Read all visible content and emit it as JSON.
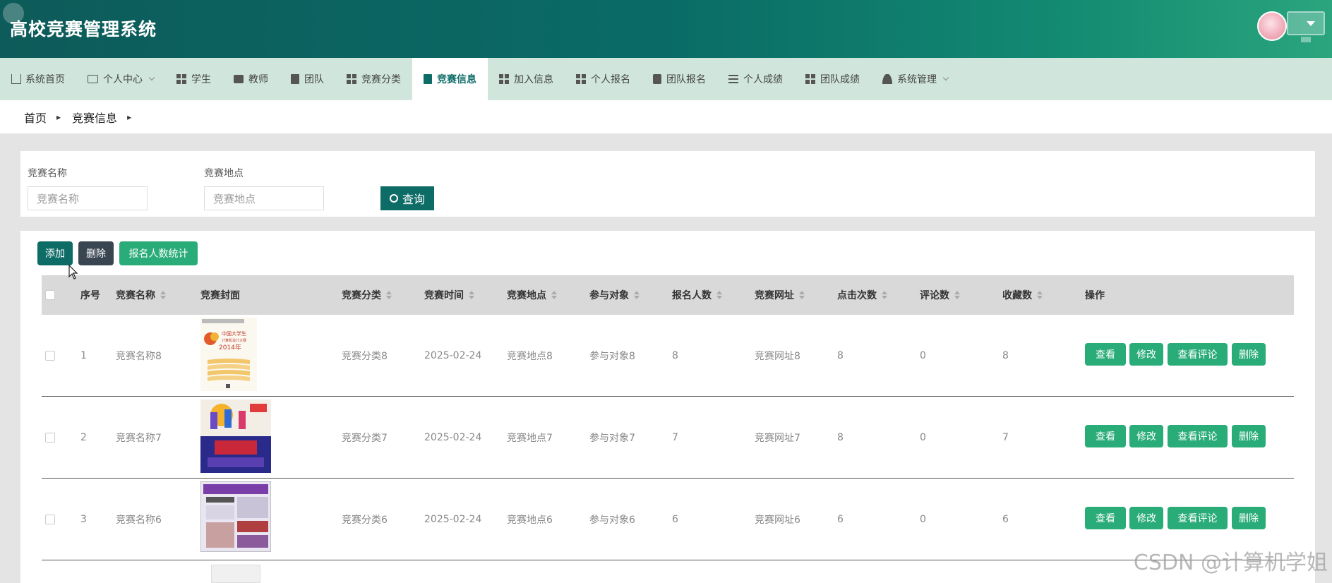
{
  "header": {
    "title": "高校竞赛管理系统"
  },
  "nav": [
    {
      "label": "系统首页",
      "icon": "home-icon"
    },
    {
      "label": "个人中心",
      "icon": "wallet-icon",
      "dropdown": true
    },
    {
      "label": "学生",
      "icon": "grid-icon"
    },
    {
      "label": "教师",
      "icon": "briefcase-icon"
    },
    {
      "label": "团队",
      "icon": "book-icon"
    },
    {
      "label": "竞赛分类",
      "icon": "grid-icon"
    },
    {
      "label": "竞赛信息",
      "icon": "book-icon",
      "active": true
    },
    {
      "label": "加入信息",
      "icon": "grid-icon"
    },
    {
      "label": "个人报名",
      "icon": "grid-icon"
    },
    {
      "label": "团队报名",
      "icon": "clipboard-icon"
    },
    {
      "label": "个人成绩",
      "icon": "list-icon"
    },
    {
      "label": "团队成绩",
      "icon": "grid-icon"
    },
    {
      "label": "系统管理",
      "icon": "user-icon",
      "dropdown": true
    }
  ],
  "breadcrumb": {
    "home": "首页",
    "current": "竞赛信息"
  },
  "search": {
    "name_label": "竞赛名称",
    "name_placeholder": "竞赛名称",
    "location_label": "竞赛地点",
    "location_placeholder": "竞赛地点",
    "query_label": "查询"
  },
  "toolbar": {
    "add": "添加",
    "delete": "删除",
    "stats": "报名人数统计"
  },
  "table": {
    "headers": {
      "index": "序号",
      "name": "竞赛名称",
      "cover": "竞赛封面",
      "category": "竞赛分类",
      "time": "竞赛时间",
      "location": "竞赛地点",
      "audience": "参与对象",
      "signups": "报名人数",
      "url": "竞赛网址",
      "clicks": "点击次数",
      "comments": "评论数",
      "favorites": "收藏数",
      "actions": "操作"
    },
    "action_labels": {
      "view": "查看",
      "edit": "修改",
      "view_comments": "查看评论",
      "delete": "删除"
    },
    "rows": [
      {
        "index": "1",
        "name": "竞赛名称8",
        "category": "竞赛分类8",
        "time": "2025-02-24",
        "location": "竞赛地点8",
        "audience": "参与对象8",
        "signups": "8",
        "url": "竞赛网址8",
        "clicks": "8",
        "comments": "0",
        "favorites": "8",
        "cover_text": "中国大学生 计算机设计大赛 2014年"
      },
      {
        "index": "2",
        "name": "竞赛名称7",
        "category": "竞赛分类7",
        "time": "2025-02-24",
        "location": "竞赛地点7",
        "audience": "参与对象7",
        "signups": "7",
        "url": "竞赛网址7",
        "clicks": "8",
        "comments": "0",
        "favorites": "7"
      },
      {
        "index": "3",
        "name": "竞赛名称6",
        "category": "竞赛分类6",
        "time": "2025-02-24",
        "location": "竞赛地点6",
        "audience": "参与对象6",
        "signups": "6",
        "url": "竞赛网址6",
        "clicks": "6",
        "comments": "0",
        "favorites": "6"
      }
    ]
  },
  "watermark": "CSDN @计算机学姐"
}
